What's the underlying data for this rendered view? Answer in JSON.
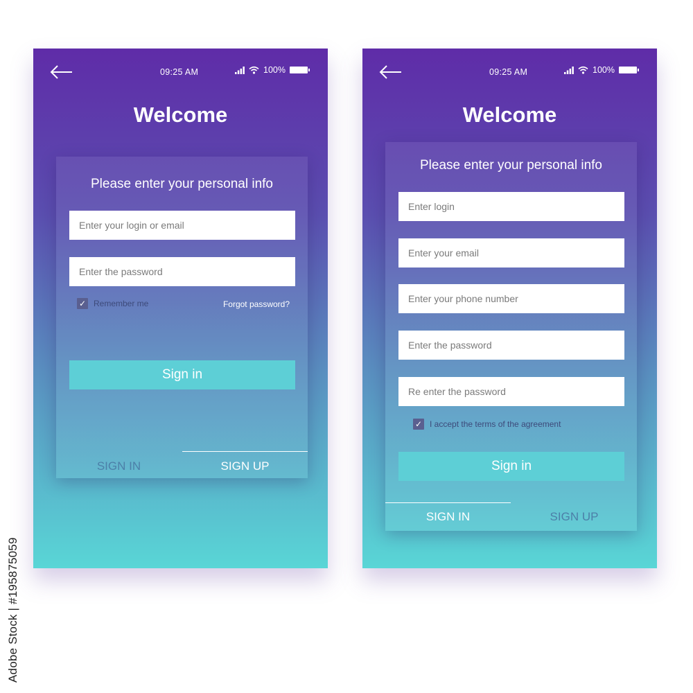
{
  "screens": [
    {
      "time": "09:25 AM",
      "battery": "100%",
      "title": "Welcome",
      "heading": "Please enter your personal info",
      "fields": [
        {
          "placeholder": "Enter your login or email"
        },
        {
          "placeholder": "Enter the password"
        }
      ],
      "remember_label": "Remember me",
      "forgot_label": "Forgot password?",
      "button_label": "Sign in",
      "tabs": [
        {
          "label": "SIGN IN",
          "active": false
        },
        {
          "label": "SIGN UP",
          "active": true
        }
      ]
    },
    {
      "time": "09:25 AM",
      "battery": "100%",
      "title": "Welcome",
      "heading": "Please enter your personal info",
      "fields": [
        {
          "placeholder": "Enter login"
        },
        {
          "placeholder": "Enter your email"
        },
        {
          "placeholder": "Enter your phone number"
        },
        {
          "placeholder": "Enter the password"
        },
        {
          "placeholder": "Re enter the password"
        }
      ],
      "terms_label": "I accept the terms of the agreement",
      "button_label": "Sign in",
      "tabs": [
        {
          "label": "SIGN IN",
          "active": true
        },
        {
          "label": "SIGN UP",
          "active": false
        }
      ]
    }
  ],
  "credit": "Adobe Stock | #195875059",
  "icons": {
    "back": "arrow-left-icon",
    "signal": "signal-icon",
    "wifi": "wifi-icon",
    "battery": "battery-icon",
    "check": "checkmark-icon"
  },
  "colors": {
    "gradient_top": "#5f2ca8",
    "gradient_bottom": "#59d6d6",
    "button": "#5dcfd6"
  }
}
